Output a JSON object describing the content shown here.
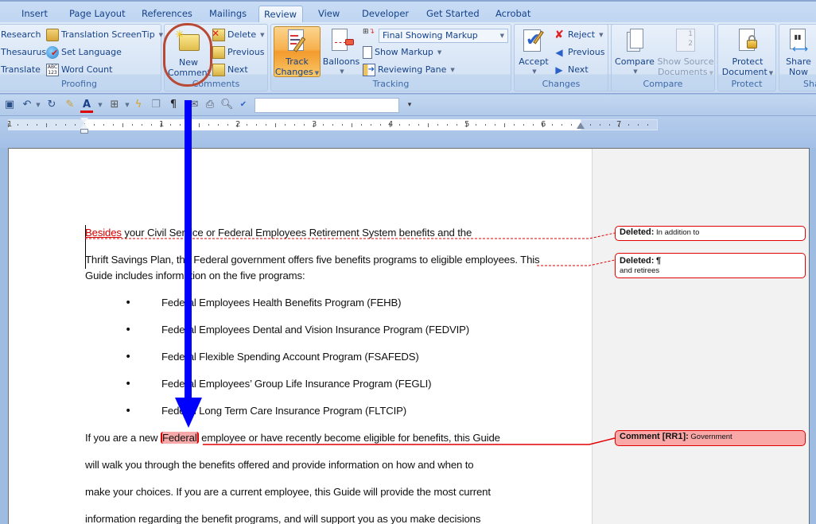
{
  "tabs": [
    {
      "label": "Insert"
    },
    {
      "label": "Page Layout"
    },
    {
      "label": "References"
    },
    {
      "label": "Mailings"
    },
    {
      "label": "Review",
      "active": true
    },
    {
      "label": "View"
    },
    {
      "label": "Developer"
    },
    {
      "label": "Get Started"
    },
    {
      "label": "Acrobat"
    }
  ],
  "ribbon": {
    "proofing": {
      "label": "Proofing",
      "research": "Research",
      "thesaurus": "Thesaurus",
      "translate": "Translate",
      "translation_screentip": "Translation ScreenTip",
      "set_language": "Set Language",
      "word_count": "Word Count"
    },
    "comments": {
      "label": "Comments",
      "new_comment_line1": "New",
      "new_comment_line2": "Comment",
      "delete": "Delete",
      "previous": "Previous",
      "next": "Next"
    },
    "tracking": {
      "label": "Tracking",
      "track_changes_line1": "Track",
      "track_changes_line2": "Changes",
      "balloons": "Balloons",
      "display_mode": "Final Showing Markup",
      "show_markup": "Show Markup",
      "reviewing_pane": "Reviewing Pane"
    },
    "changes": {
      "label": "Changes",
      "accept": "Accept",
      "reject": "Reject",
      "previous": "Previous",
      "next": "Next"
    },
    "compare": {
      "label": "Compare",
      "compare": "Compare",
      "show_source_line1": "Show Source",
      "show_source_line2": "Documents"
    },
    "protect": {
      "label": "Protect",
      "protect_line1": "Protect",
      "protect_line2": "Document"
    },
    "share": {
      "label": "Sha",
      "share_line1": "Share",
      "share_line2": "Now"
    }
  },
  "qat": {
    "input_value": ""
  },
  "ruler": {
    "numbers": [
      "1",
      "1",
      "2",
      "3",
      "4",
      "5",
      "6",
      "7"
    ]
  },
  "document": {
    "p1_inserted": "Besides",
    "p1_rest": " your Civil Service or Federal Employees Retirement System benefits and the",
    "p2_line1": "Thrift Savings Plan, the Federal government offers five benefits programs to eligible employees. This",
    "p2_line2": "Guide includes information on the five programs:",
    "bullets": [
      "Federal Employees Health Benefits Program (FEHB)",
      "Federal Employees Dental and Vision Insurance Program (FEDVIP)",
      "Federal Flexible Spending Account Program (FSAFEDS)",
      "Federal Employees’ Group Life Insurance Program (FEGLI)",
      "Federal Long Term Care Insurance Program (FLTCIP)"
    ],
    "p3_before": "If you are a new ",
    "p3_commented": "Federal",
    "p3_after": " employee or have recently become eligible for benefits, this Guide",
    "p3_line2": "will walk you through the benefits offered and provide information on how and when to",
    "p3_line3": "make your choices. If you are a current employee, this Guide will provide the most current",
    "p3_line4": "information regarding the benefit programs, and will support you as you make decisions"
  },
  "balloons": [
    {
      "type": "deletion",
      "title": "Deleted:",
      "text": "In addition to"
    },
    {
      "type": "deletion",
      "title": "Deleted:",
      "title_suffix": "¶",
      "text": "and retirees"
    },
    {
      "type": "comment",
      "title": "Comment [RR1]:",
      "text": "Government"
    }
  ],
  "colors": {
    "annotation_arrow": "#0000ff",
    "highlight_oval": "#b84a35",
    "revision": "#e00000",
    "comment_fill": "#f9a7a7"
  }
}
